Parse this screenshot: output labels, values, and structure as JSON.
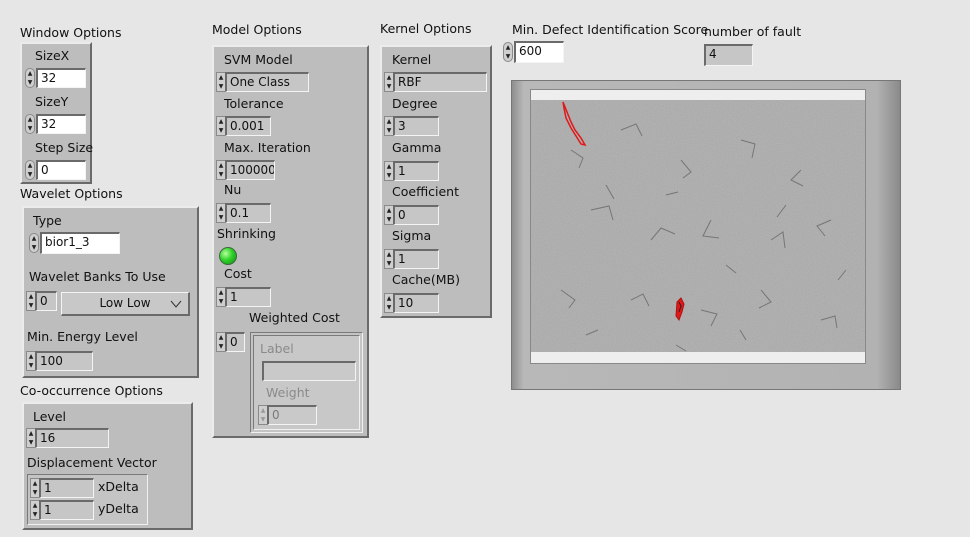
{
  "window_options": {
    "title": "Window Options",
    "sizex": {
      "label": "SizeX",
      "value": "32"
    },
    "sizey": {
      "label": "SizeY",
      "value": "32"
    },
    "step": {
      "label": "Step Size",
      "value": "0"
    }
  },
  "wavelet_options": {
    "title": "Wavelet Options",
    "type_label": "Type",
    "type_value": "bior1_3",
    "banks_label": "Wavelet Banks To Use",
    "banks_index": "0",
    "banks_value": "Low Low",
    "energy_label": "Min. Energy Level",
    "energy_value": "100"
  },
  "cooccurrence_options": {
    "title": "Co-occurrence Options",
    "level_label": "Level",
    "level_value": "16",
    "disp_label": "Displacement Vector",
    "xdelta_value": "1",
    "xdelta_label": "xDelta",
    "ydelta_value": "1",
    "ydelta_label": "yDelta"
  },
  "model_options": {
    "title": "Model Options",
    "svm_label": "SVM Model",
    "svm_value": "One Class",
    "tolerance_label": "Tolerance",
    "tolerance_value": "0.001",
    "maxiter_label": "Max. Iteration",
    "maxiter_value": "100000",
    "nu_label": "Nu",
    "nu_value": "0.1",
    "shrinking_label": "Shrinking",
    "shrinking_on": true,
    "cost_label": "Cost",
    "cost_value": "1",
    "weighted_label": "Weighted Cost",
    "weighted_index": "0",
    "label_label": "Label",
    "label_value": "",
    "weight_label": "Weight",
    "weight_value": "0"
  },
  "kernel_options": {
    "title": "Kernel Options",
    "kernel_label": "Kernel",
    "kernel_value": "RBF",
    "degree_label": "Degree",
    "degree_value": "3",
    "gamma_label": "Gamma",
    "gamma_value": "1",
    "coef_label": "Coefficient",
    "coef_value": "0",
    "sigma_label": "Sigma",
    "sigma_value": "1",
    "cache_label": "Cache(MB)",
    "cache_value": "10"
  },
  "score": {
    "label": "Min. Defect Identification Score",
    "value": "600"
  },
  "fault": {
    "label": "number of fault",
    "value": "4"
  },
  "colors": {
    "bg": "#e6e6e6",
    "cluster": "#bdbdbd",
    "defect_outline": "#e01818"
  }
}
